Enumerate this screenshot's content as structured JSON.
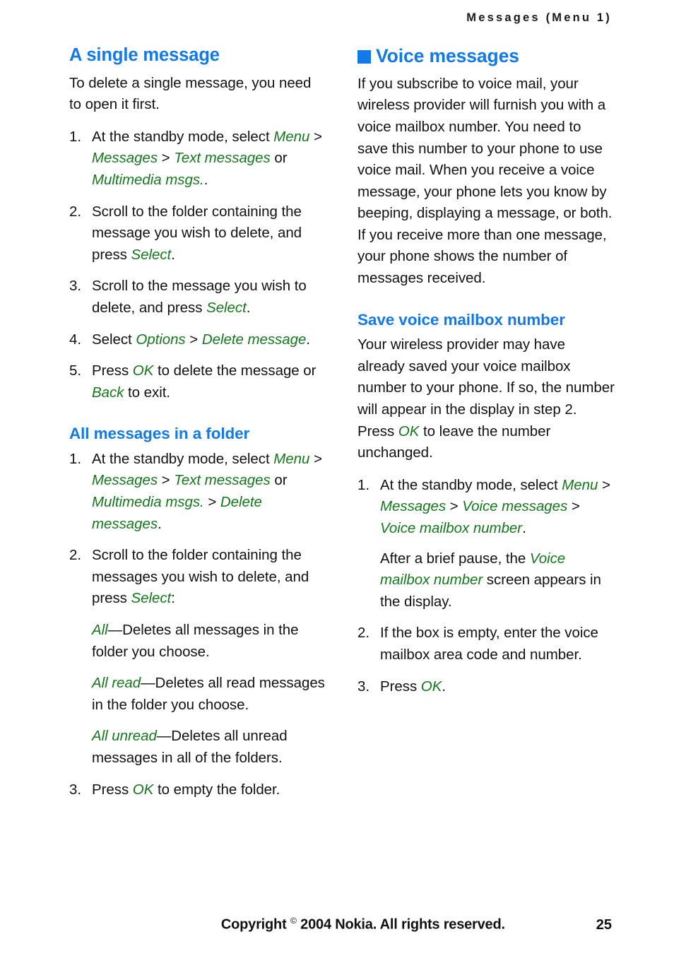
{
  "header": {
    "running_head": "Messages (Menu 1)"
  },
  "colors": {
    "heading_blue": "#1279e8",
    "ui_green": "#16781d",
    "body_black": "#121212"
  },
  "left_column": {
    "section_a": {
      "heading": "A single message",
      "intro": "To delete a single message, you need to open it first.",
      "steps": [
        {
          "number": "1.",
          "parts": [
            {
              "t": "plain",
              "s": "At the standby mode, select "
            },
            {
              "t": "ui",
              "s": "Menu"
            },
            {
              "t": "plain",
              "s": " > "
            },
            {
              "t": "ui",
              "s": "Messages"
            },
            {
              "t": "plain",
              "s": " > "
            },
            {
              "t": "ui",
              "s": "Text messages"
            },
            {
              "t": "plain",
              "s": " or "
            },
            {
              "t": "ui",
              "s": "Multimedia msgs."
            },
            {
              "t": "plain",
              "s": "."
            }
          ]
        },
        {
          "number": "2.",
          "parts": [
            {
              "t": "plain",
              "s": "Scroll to the folder containing the message you wish to delete, and press "
            },
            {
              "t": "ui",
              "s": "Select"
            },
            {
              "t": "plain",
              "s": "."
            }
          ]
        },
        {
          "number": "3.",
          "parts": [
            {
              "t": "plain",
              "s": "Scroll to the message you wish to delete, and press "
            },
            {
              "t": "ui",
              "s": "Select"
            },
            {
              "t": "plain",
              "s": "."
            }
          ]
        },
        {
          "number": "4.",
          "parts": [
            {
              "t": "plain",
              "s": "Select "
            },
            {
              "t": "ui",
              "s": "Options"
            },
            {
              "t": "plain",
              "s": " > "
            },
            {
              "t": "ui",
              "s": "Delete message"
            },
            {
              "t": "plain",
              "s": "."
            }
          ]
        },
        {
          "number": "5.",
          "parts": [
            {
              "t": "plain",
              "s": "Press "
            },
            {
              "t": "ui",
              "s": "OK"
            },
            {
              "t": "plain",
              "s": " to delete the message or "
            },
            {
              "t": "ui",
              "s": "Back"
            },
            {
              "t": "plain",
              "s": " to exit."
            }
          ]
        }
      ]
    },
    "section_b": {
      "heading": "All messages in a folder",
      "steps": [
        {
          "number": "1.",
          "parts": [
            {
              "t": "plain",
              "s": "At the standby mode, select "
            },
            {
              "t": "ui",
              "s": "Menu"
            },
            {
              "t": "plain",
              "s": " > "
            },
            {
              "t": "ui",
              "s": "Messages"
            },
            {
              "t": "plain",
              "s": " > "
            },
            {
              "t": "ui",
              "s": "Text messages"
            },
            {
              "t": "plain",
              "s": " or "
            },
            {
              "t": "ui",
              "s": "Multimedia msgs."
            },
            {
              "t": "plain",
              "s": " > "
            },
            {
              "t": "ui",
              "s": "Delete messages"
            },
            {
              "t": "plain",
              "s": "."
            }
          ]
        },
        {
          "number": "2.",
          "parts": [
            {
              "t": "plain",
              "s": "Scroll to the folder containing the messages you wish to delete, and press "
            },
            {
              "t": "ui",
              "s": "Select"
            },
            {
              "t": "plain",
              "s": ":"
            }
          ]
        },
        {
          "number": "3.",
          "parts": [
            {
              "t": "plain",
              "s": "Press "
            },
            {
              "t": "ui",
              "s": "OK"
            },
            {
              "t": "plain",
              "s": " to empty the folder."
            }
          ]
        }
      ],
      "definitions": [
        {
          "term": "All",
          "dash": "—",
          "desc": "Deletes all messages in the folder you choose."
        },
        {
          "term": "All read",
          "dash": "—",
          "desc": "Deletes all read messages in the folder you choose."
        },
        {
          "term": "All unread",
          "dash": "—",
          "desc": "Deletes all unread messages in all of the folders."
        }
      ]
    }
  },
  "right_column": {
    "section_voice": {
      "bullet_icon": "blue-square-bullet",
      "heading": "Voice messages",
      "body": "If you subscribe to voice mail, your wireless provider will furnish you with a voice mailbox number. You need to save this number to your phone to use voice mail. When you receive a voice message, your phone lets you know by beeping, displaying a message, or both. If you receive more than one message, your phone shows the number of messages received."
    },
    "section_save": {
      "heading": "Save voice mailbox number",
      "intro_parts": [
        {
          "t": "plain",
          "s": "Your wireless provider may have already saved your voice mailbox number to your phone. If so, the number will appear in the display in step 2. Press "
        },
        {
          "t": "ui",
          "s": "OK"
        },
        {
          "t": "plain",
          "s": " to leave the number unchanged."
        }
      ],
      "steps": [
        {
          "number": "1.",
          "parts": [
            {
              "t": "plain",
              "s": "At the standby mode, select "
            },
            {
              "t": "ui",
              "s": "Menu"
            },
            {
              "t": "plain",
              "s": " > "
            },
            {
              "t": "ui",
              "s": "Messages"
            },
            {
              "t": "plain",
              "s": " > "
            },
            {
              "t": "ui",
              "s": "Voice messages"
            },
            {
              "t": "plain",
              "s": " > "
            },
            {
              "t": "ui",
              "s": "Voice mailbox number"
            },
            {
              "t": "plain",
              "s": "."
            }
          ],
          "sub_parts": [
            {
              "t": "plain",
              "s": "After a brief pause, the "
            },
            {
              "t": "ui",
              "s": "Voice mailbox number"
            },
            {
              "t": "plain",
              "s": " screen appears in the display."
            }
          ]
        },
        {
          "number": "2.",
          "parts": [
            {
              "t": "plain",
              "s": "If the box is empty, enter the voice mailbox area code and number."
            }
          ]
        },
        {
          "number": "3.",
          "parts": [
            {
              "t": "plain",
              "s": "Press "
            },
            {
              "t": "ui",
              "s": "OK"
            },
            {
              "t": "plain",
              "s": "."
            }
          ]
        }
      ]
    }
  },
  "footer": {
    "copyright_prefix": "Copyright ",
    "copyright_symbol": "©",
    "copyright_suffix": " 2004 Nokia. All rights reserved.",
    "page_number": "25"
  }
}
